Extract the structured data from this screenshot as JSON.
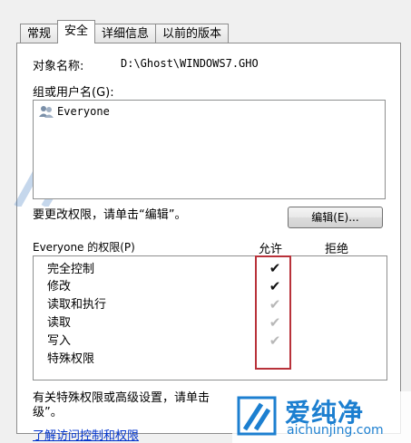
{
  "tabs": [
    {
      "label": "常规",
      "active": false
    },
    {
      "label": "安全",
      "active": true
    },
    {
      "label": "详细信息",
      "active": false
    },
    {
      "label": "以前的版本",
      "active": false
    }
  ],
  "object": {
    "label": "对象名称:",
    "value": "D:\\Ghost\\WINDOWS7.GHO"
  },
  "groups": {
    "label": "组或用户名(G):",
    "items": [
      {
        "name": "Everyone",
        "icon": "users-icon"
      }
    ]
  },
  "edit": {
    "hint": "要更改权限，请单击“编辑”。",
    "button_label": "编辑(E)..."
  },
  "permissions": {
    "label": "Everyone 的权限(P)",
    "allow_header": "允许",
    "deny_header": "拒绝",
    "rows": [
      {
        "name": "完全控制",
        "allow": "✔",
        "allow_state": "explicit"
      },
      {
        "name": "修改",
        "allow": "✔",
        "allow_state": "explicit"
      },
      {
        "name": "读取和执行",
        "allow": "✔",
        "allow_state": "inherited"
      },
      {
        "name": "读取",
        "allow": "✔",
        "allow_state": "inherited"
      },
      {
        "name": "写入",
        "allow": "✔",
        "allow_state": "inherited"
      },
      {
        "name": "特殊权限",
        "allow": "",
        "allow_state": "none"
      }
    ]
  },
  "advanced": {
    "hint_line1": "有关特殊权限或高级设置，请单击",
    "hint_line2": "级”。"
  },
  "link": {
    "label": "了解访问控制和权限"
  },
  "watermark": {
    "cn": "爱纯净",
    "en": "aichunjing.com"
  },
  "colors": {
    "highlight": "#b8323a",
    "link": "#0033cc",
    "watermark": "#1c7fd0"
  }
}
